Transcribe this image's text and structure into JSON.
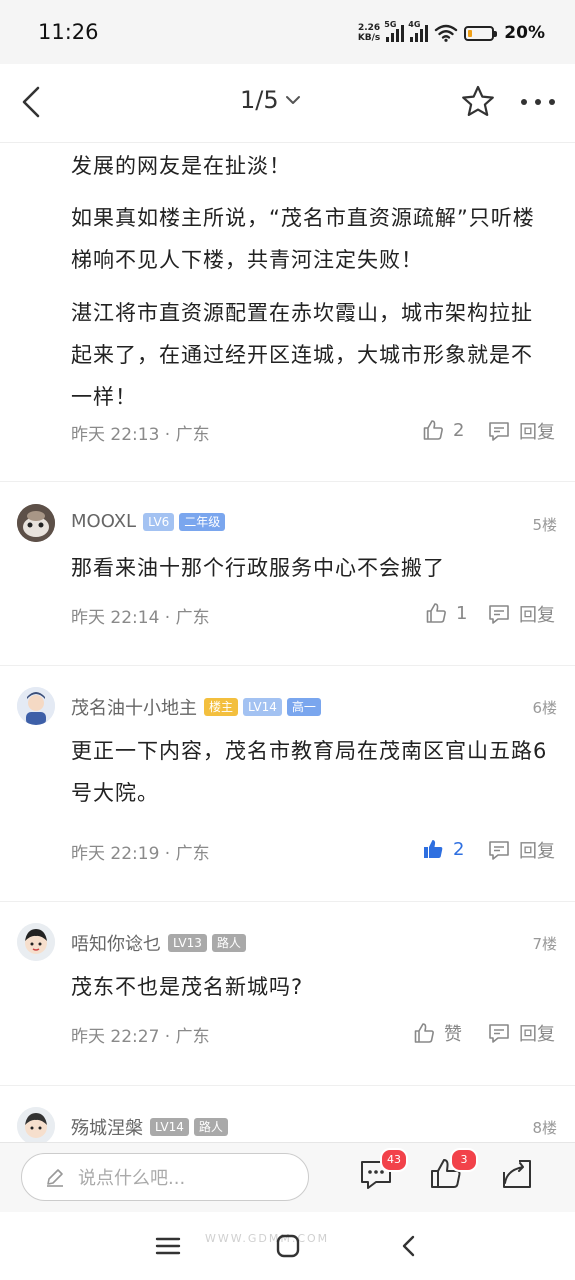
{
  "status_bar": {
    "time": "11:26",
    "net_speed_value": "2.26",
    "net_speed_unit": "KB/s",
    "signal1_label": "5G",
    "signal2_label": "4G",
    "battery": "20%",
    "battery_level": 0.2
  },
  "nav": {
    "pager": "1/5"
  },
  "post": {
    "paragraphs": [
      "发展的网友是在扯淡！",
      "如果真如楼主所说，“茂名市直资源疏解”只听楼梯响不见人下楼，共青河注定失败！",
      "湛江将市直资源配置在赤坎霞山，城市架构拉扯起来了，在通过经开区连城，大城市形象就是不一样！"
    ],
    "time_location": "昨天 22:13 · 广东",
    "like_count": "2",
    "reply_label": "回复"
  },
  "comments": [
    {
      "username": "MOOXL",
      "badges": [
        "LV6",
        "二年级"
      ],
      "floor": "5楼",
      "content": "那看来油十那个行政服务中心不会搬了",
      "time_location": "昨天 22:14 · 广东",
      "like": "1",
      "reply": "回复"
    },
    {
      "username": "茂名油十小地主",
      "badges": [
        "楼主",
        "LV14",
        "高一"
      ],
      "floor": "6楼",
      "content": "更正一下内容，茂名市教育局在茂南区官山五路6号大院。",
      "time_location": "昨天 22:19 · 广东",
      "like": "2",
      "reply": "回复"
    },
    {
      "username": "唔知你谂乜",
      "badges": [
        "LV13",
        "路人"
      ],
      "floor": "7楼",
      "content": "茂东不也是茂名新城吗?",
      "time_location": "昨天 22:27 · 广东",
      "like": "赞",
      "reply": "回复"
    },
    {
      "username": "殇城涅槃",
      "badges": [
        "LV14",
        "路人"
      ],
      "floor": "8楼"
    }
  ],
  "bottom_bar": {
    "input_placeholder": "说点什么吧...",
    "comment_count": "43",
    "like_count": "3"
  },
  "watermark": "WWW.GDMM.COM"
}
